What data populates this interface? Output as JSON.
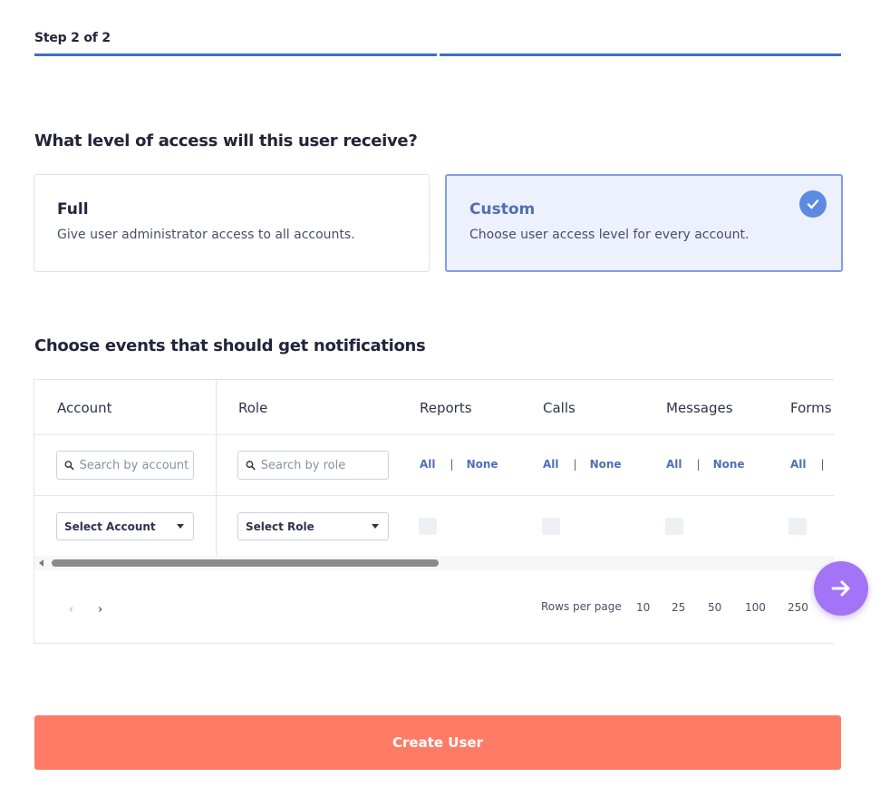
{
  "stepper": {
    "label": "Step 2 of 2",
    "current": 2,
    "total": 2
  },
  "access": {
    "title": "What level of access will this user receive?",
    "options": [
      {
        "title": "Full",
        "description": "Give user administrator access to all accounts.",
        "selected": false
      },
      {
        "title": "Custom",
        "description": "Choose user access level for every account.",
        "selected": true
      }
    ]
  },
  "notifications": {
    "title": "Choose events that should get notifications",
    "columns": {
      "account": "Account",
      "role": "Role",
      "reports": "Reports",
      "calls": "Calls",
      "messages": "Messages",
      "forms": "Forms"
    },
    "account_search_placeholder": "Search by account",
    "role_search_placeholder": "Search by role",
    "all_label": "All",
    "none_label": "None",
    "select_account": "Select Account",
    "select_role": "Select Role",
    "pagination": {
      "prev": "‹",
      "next": "›",
      "rows_per_page_label": "Rows per page",
      "rows_options": [
        "10",
        "25",
        "50",
        "100",
        "250"
      ]
    }
  },
  "next_fab_icon": "arrow-right-icon",
  "create_button": "Create User",
  "colors": {
    "accent_blue": "#3b6fd4",
    "selected_card_bg": "#edf0fd",
    "link_blue": "#4f6fb6",
    "fab_purple": "#a374f6",
    "create_button": "#ff7b66"
  }
}
